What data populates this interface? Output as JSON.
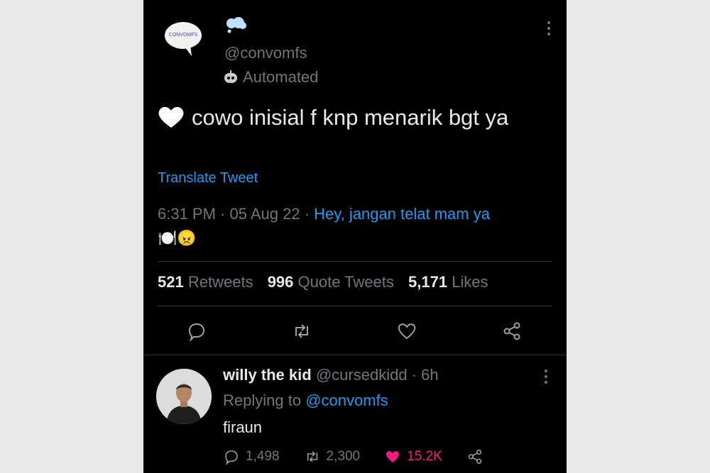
{
  "tweet": {
    "avatar_logo_text": "CONVOMFS",
    "handle": "@convomfs",
    "automated_label": "Automated",
    "text": "cowo inisial f knp menarik bgt ya",
    "translate_label": "Translate Tweet",
    "timestamp": "6:31 PM · 05 Aug 22 · ",
    "source_label": "Hey, jangan telat mam ya",
    "source_emojis": "🍽️😠",
    "stats": {
      "retweets_count": "521",
      "retweets_label": "Retweets",
      "quotes_count": "996",
      "quotes_label": "Quote Tweets",
      "likes_count": "5,171",
      "likes_label": "Likes"
    },
    "actions": [
      "reply-icon",
      "retweet-icon",
      "like-icon",
      "share-icon"
    ]
  },
  "reply": {
    "name": "willy the kid",
    "handle": "@cursedkidd",
    "time": "· 6h",
    "replying_prefix": "Replying to",
    "replying_handle": "@convomfs",
    "text": "firaun",
    "replies": "1,498",
    "retweets": "2,300",
    "likes": "15.2K"
  },
  "colors": {
    "background": "#000000",
    "text": "#e7e9ea",
    "muted": "#71767b",
    "link": "#1d9bf0",
    "like": "#f91880"
  }
}
